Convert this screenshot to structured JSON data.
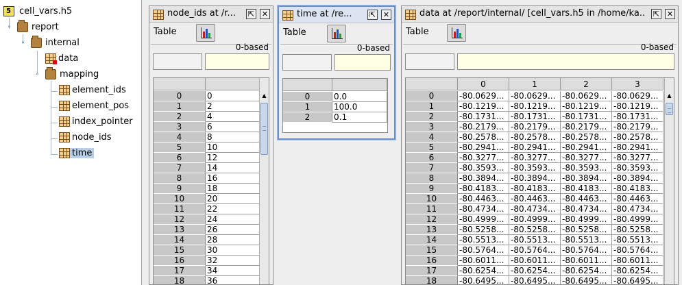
{
  "tree": {
    "root": {
      "label": "cell_vars.h5",
      "icon": "hdf5-file-icon"
    },
    "report": {
      "label": "report",
      "icon": "folder-icon"
    },
    "internal": {
      "label": "internal",
      "icon": "folder-icon"
    },
    "data": {
      "label": "data",
      "icon": "dataset-icon"
    },
    "mapping": {
      "label": "mapping",
      "icon": "folder-icon"
    },
    "element_ids": {
      "label": "element_ids",
      "icon": "dataset-icon"
    },
    "element_pos": {
      "label": "element_pos",
      "icon": "dataset-icon"
    },
    "index_pointer": {
      "label": "index_pointer",
      "icon": "dataset-icon"
    },
    "node_ids": {
      "label": "node_ids",
      "icon": "dataset-icon"
    },
    "time": {
      "label": "time",
      "icon": "dataset-icon"
    }
  },
  "panels": {
    "node_ids": {
      "title": "node_ids  at  /r...",
      "menu": "Table",
      "based": "0-based",
      "rows": [
        "0",
        "1",
        "2",
        "3",
        "4",
        "5",
        "6",
        "7",
        "8",
        "9",
        "10",
        "11",
        "12",
        "13",
        "14",
        "15",
        "16",
        "17",
        "18"
      ],
      "values": [
        "0",
        "2",
        "4",
        "6",
        "8",
        "10",
        "12",
        "14",
        "16",
        "18",
        "20",
        "22",
        "24",
        "26",
        "28",
        "30",
        "32",
        "34",
        "36"
      ]
    },
    "time": {
      "title": "time  at  /re...",
      "menu": "Table",
      "based": "0-based",
      "rows": [
        "0",
        "1",
        "2"
      ],
      "values": [
        "0.0",
        "100.0",
        "0.1"
      ]
    },
    "data": {
      "title": "data  at  /report/internal/  [cell_vars.h5  in  /home/ka...",
      "menu": "Table",
      "based": "0-based",
      "columns": [
        "0",
        "1",
        "2",
        "3"
      ],
      "rows": [
        "0",
        "1",
        "2",
        "3",
        "4",
        "5",
        "6",
        "7",
        "8",
        "9",
        "10",
        "11",
        "12",
        "13",
        "14",
        "15",
        "16",
        "17",
        "18"
      ],
      "values": [
        "-80.0629...",
        "-80.1219...",
        "-80.1731...",
        "-80.2179...",
        "-80.2578...",
        "-80.2941...",
        "-80.3277...",
        "-80.3593...",
        "-80.3894...",
        "-80.4183...",
        "-80.4463...",
        "-80.4734...",
        "-80.4999...",
        "-80.5258...",
        "-80.5513...",
        "-80.5764...",
        "-80.6011...",
        "-80.6254...",
        "-80.6495..."
      ]
    }
  },
  "colors": {
    "selection": "#b8cfe5",
    "active_border": "#6b8fc9",
    "cell_value_bg": "#ffffe6"
  }
}
